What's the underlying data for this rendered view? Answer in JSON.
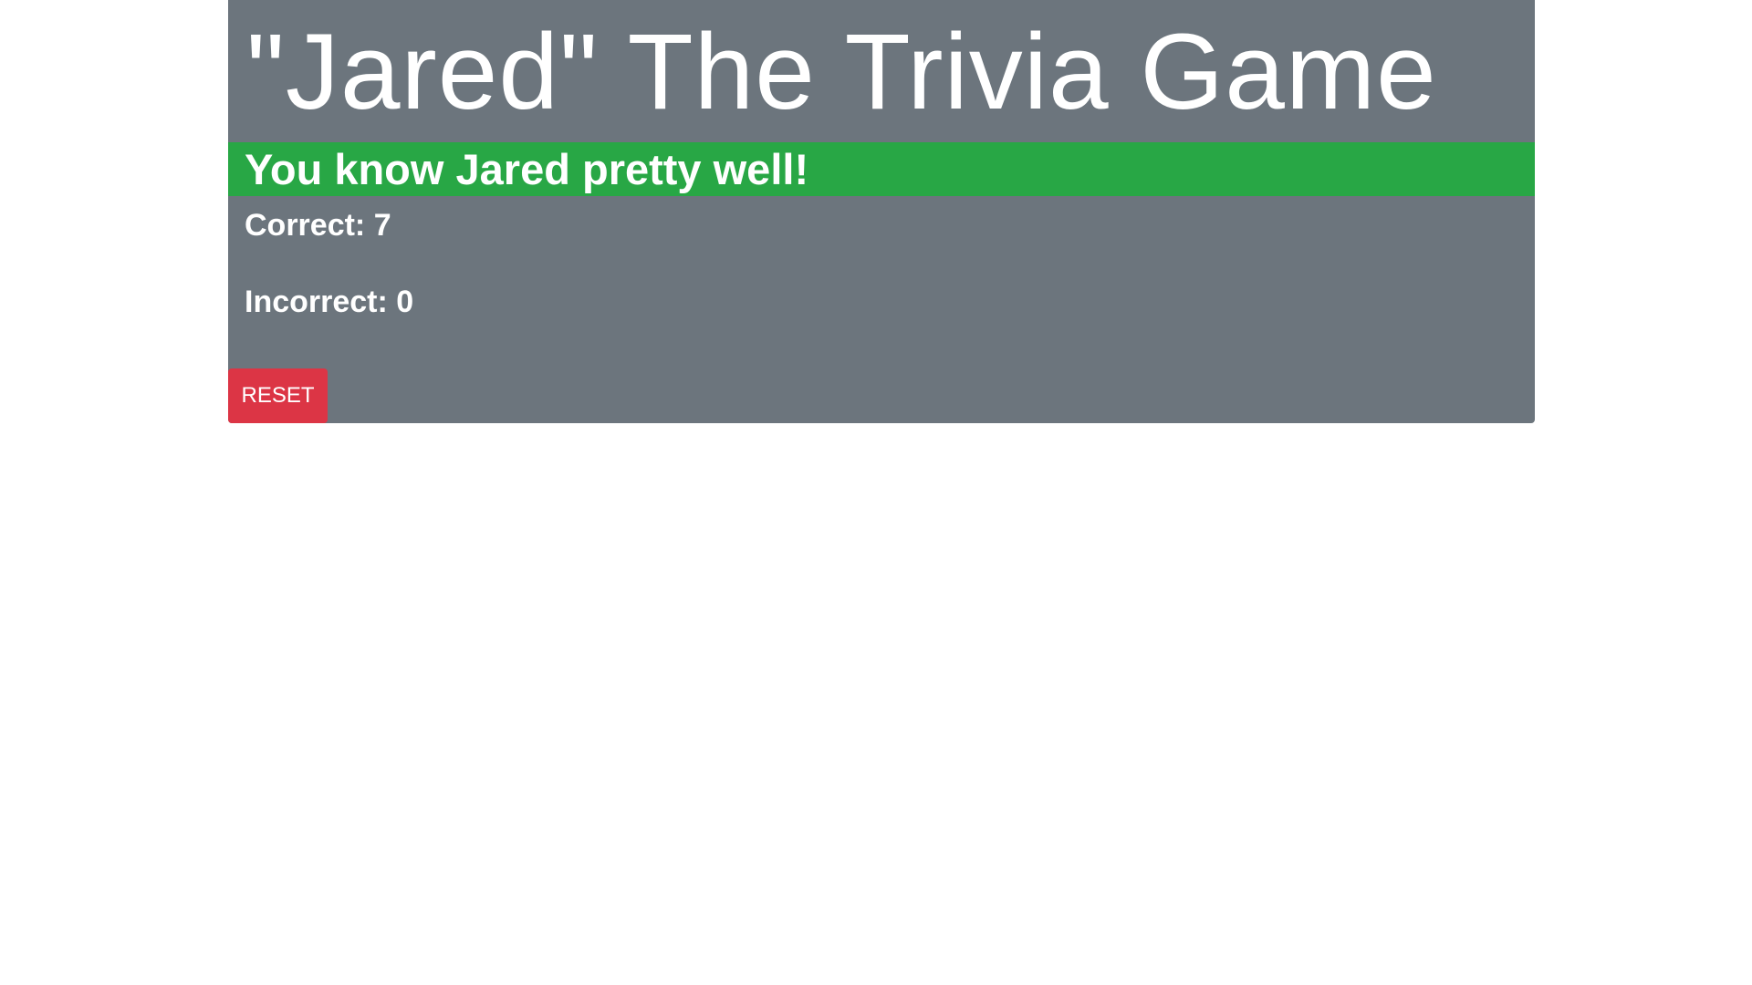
{
  "header": {
    "title": "\"Jared\" The Trivia Game"
  },
  "result": {
    "message": "You know Jared pretty well!",
    "color": "#28a745"
  },
  "stats": {
    "correct_text": "Correct: 7",
    "incorrect_text": "Incorrect: 0"
  },
  "actions": {
    "reset_label": "RESET",
    "reset_color": "#dc3545"
  },
  "theme": {
    "card_background": "#6c757d"
  }
}
